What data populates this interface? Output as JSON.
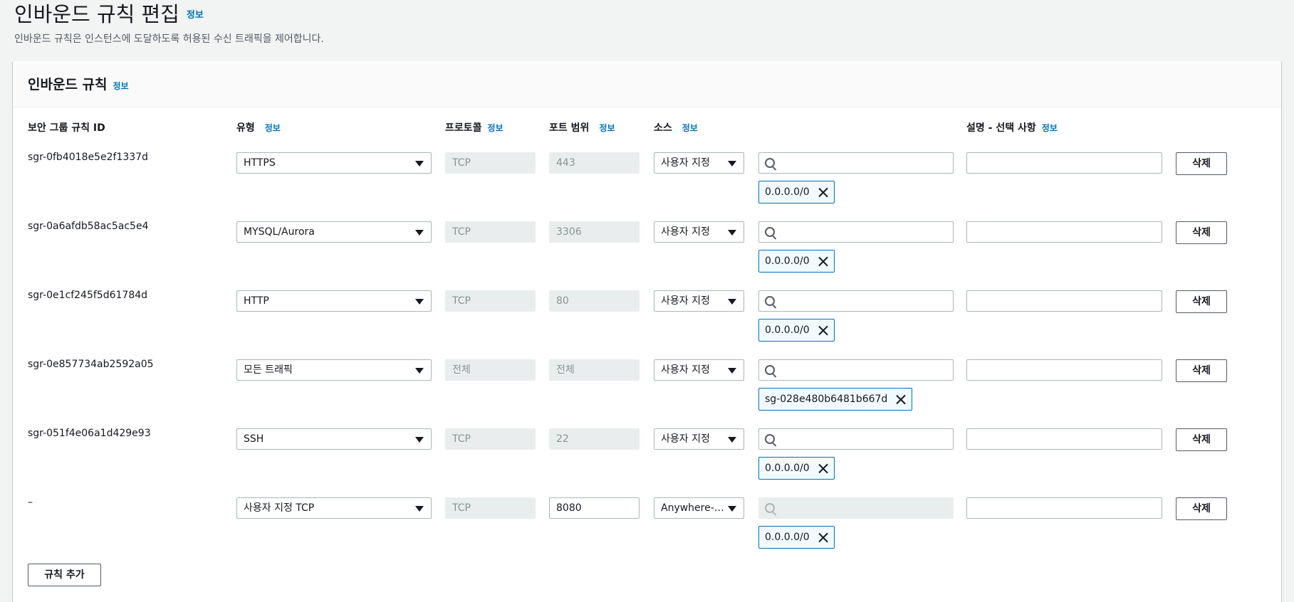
{
  "header": {
    "title": "인바운드 규칙 편집",
    "title_info": "정보",
    "description": "인바운드 규칙은 인스턴스에 도달하도록 허용된 수신 트래픽을 제어합니다."
  },
  "panel": {
    "title": "인바운드 규칙",
    "title_info": "정보",
    "columns": {
      "rule_id": "보안 그룹 규칙 ID",
      "type": "유형",
      "type_info": "정보",
      "protocol": "프로토콜",
      "protocol_info": "정보",
      "port": "포트 범위",
      "port_info": "정보",
      "source": "소스",
      "source_info": "정보",
      "description": "설명 - 선택 사항",
      "description_info": "정보"
    },
    "rows": [
      {
        "id": "sgr-0fb4018e5e2f1337d",
        "type": "HTTPS",
        "protocol": "TCP",
        "port": "443",
        "source": "사용자 지정",
        "token": "0.0.0.0/0",
        "delete": "삭제"
      },
      {
        "id": "sgr-0a6afdb58ac5ac5e4",
        "type": "MYSQL/Aurora",
        "protocol": "TCP",
        "port": "3306",
        "source": "사용자 지정",
        "token": "0.0.0.0/0",
        "delete": "삭제"
      },
      {
        "id": "sgr-0e1cf245f5d61784d",
        "type": "HTTP",
        "protocol": "TCP",
        "port": "80",
        "source": "사용자 지정",
        "token": "0.0.0.0/0",
        "delete": "삭제"
      },
      {
        "id": "sgr-0e857734ab2592a05",
        "type": "모든 트래픽",
        "protocol": "전체",
        "port": "전체",
        "source": "사용자 지정",
        "token": "sg-028e480b6481b667d",
        "delete": "삭제"
      },
      {
        "id": "sgr-051f4e06a1d429e93",
        "type": "SSH",
        "protocol": "TCP",
        "port": "22",
        "source": "사용자 지정",
        "token": "0.0.0.0/0",
        "delete": "삭제"
      },
      {
        "id": "–",
        "type": "사용자 지정 TCP",
        "protocol": "TCP",
        "port": "8080",
        "source": "Anywhere-…",
        "token": "0.0.0.0/0",
        "delete": "삭제"
      }
    ],
    "add_rule_label": "규칙 추가"
  }
}
